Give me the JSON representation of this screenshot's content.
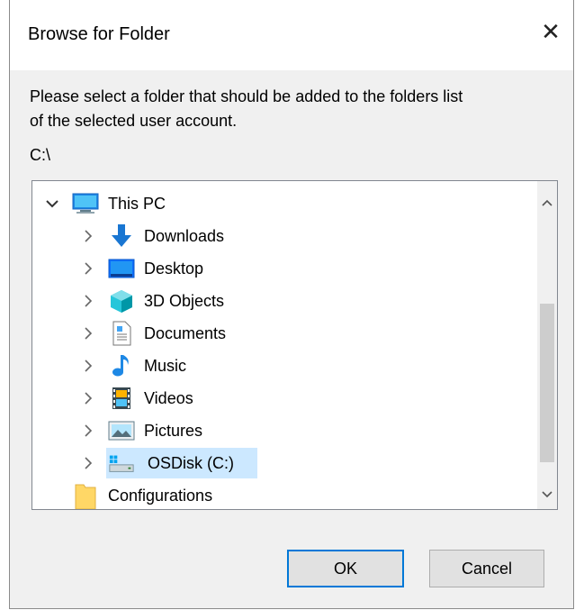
{
  "window": {
    "title": "Browse for Folder",
    "close_glyph": "✕"
  },
  "prompt": {
    "line1": "Please select a folder that should be added to the folders list",
    "line2": "of the selected user account."
  },
  "current_path": "C:\\",
  "tree": {
    "root": {
      "label": "This PC",
      "icon": "this-pc-icon",
      "expanded": true
    },
    "items": [
      {
        "label": "Downloads",
        "icon": "downloads-icon"
      },
      {
        "label": "Desktop",
        "icon": "desktop-icon"
      },
      {
        "label": "3D Objects",
        "icon": "3d-objects-icon"
      },
      {
        "label": "Documents",
        "icon": "documents-icon"
      },
      {
        "label": "Music",
        "icon": "music-icon"
      },
      {
        "label": "Videos",
        "icon": "videos-icon"
      },
      {
        "label": "Pictures",
        "icon": "pictures-icon"
      },
      {
        "label": "OSDisk (C:)",
        "icon": "drive-icon",
        "selected": true
      }
    ],
    "sibling": {
      "label": "Configurations",
      "icon": "folder-icon"
    }
  },
  "buttons": {
    "ok": "OK",
    "cancel": "Cancel"
  },
  "colors": {
    "selection": "#cce8ff",
    "accent": "#0078d7"
  }
}
